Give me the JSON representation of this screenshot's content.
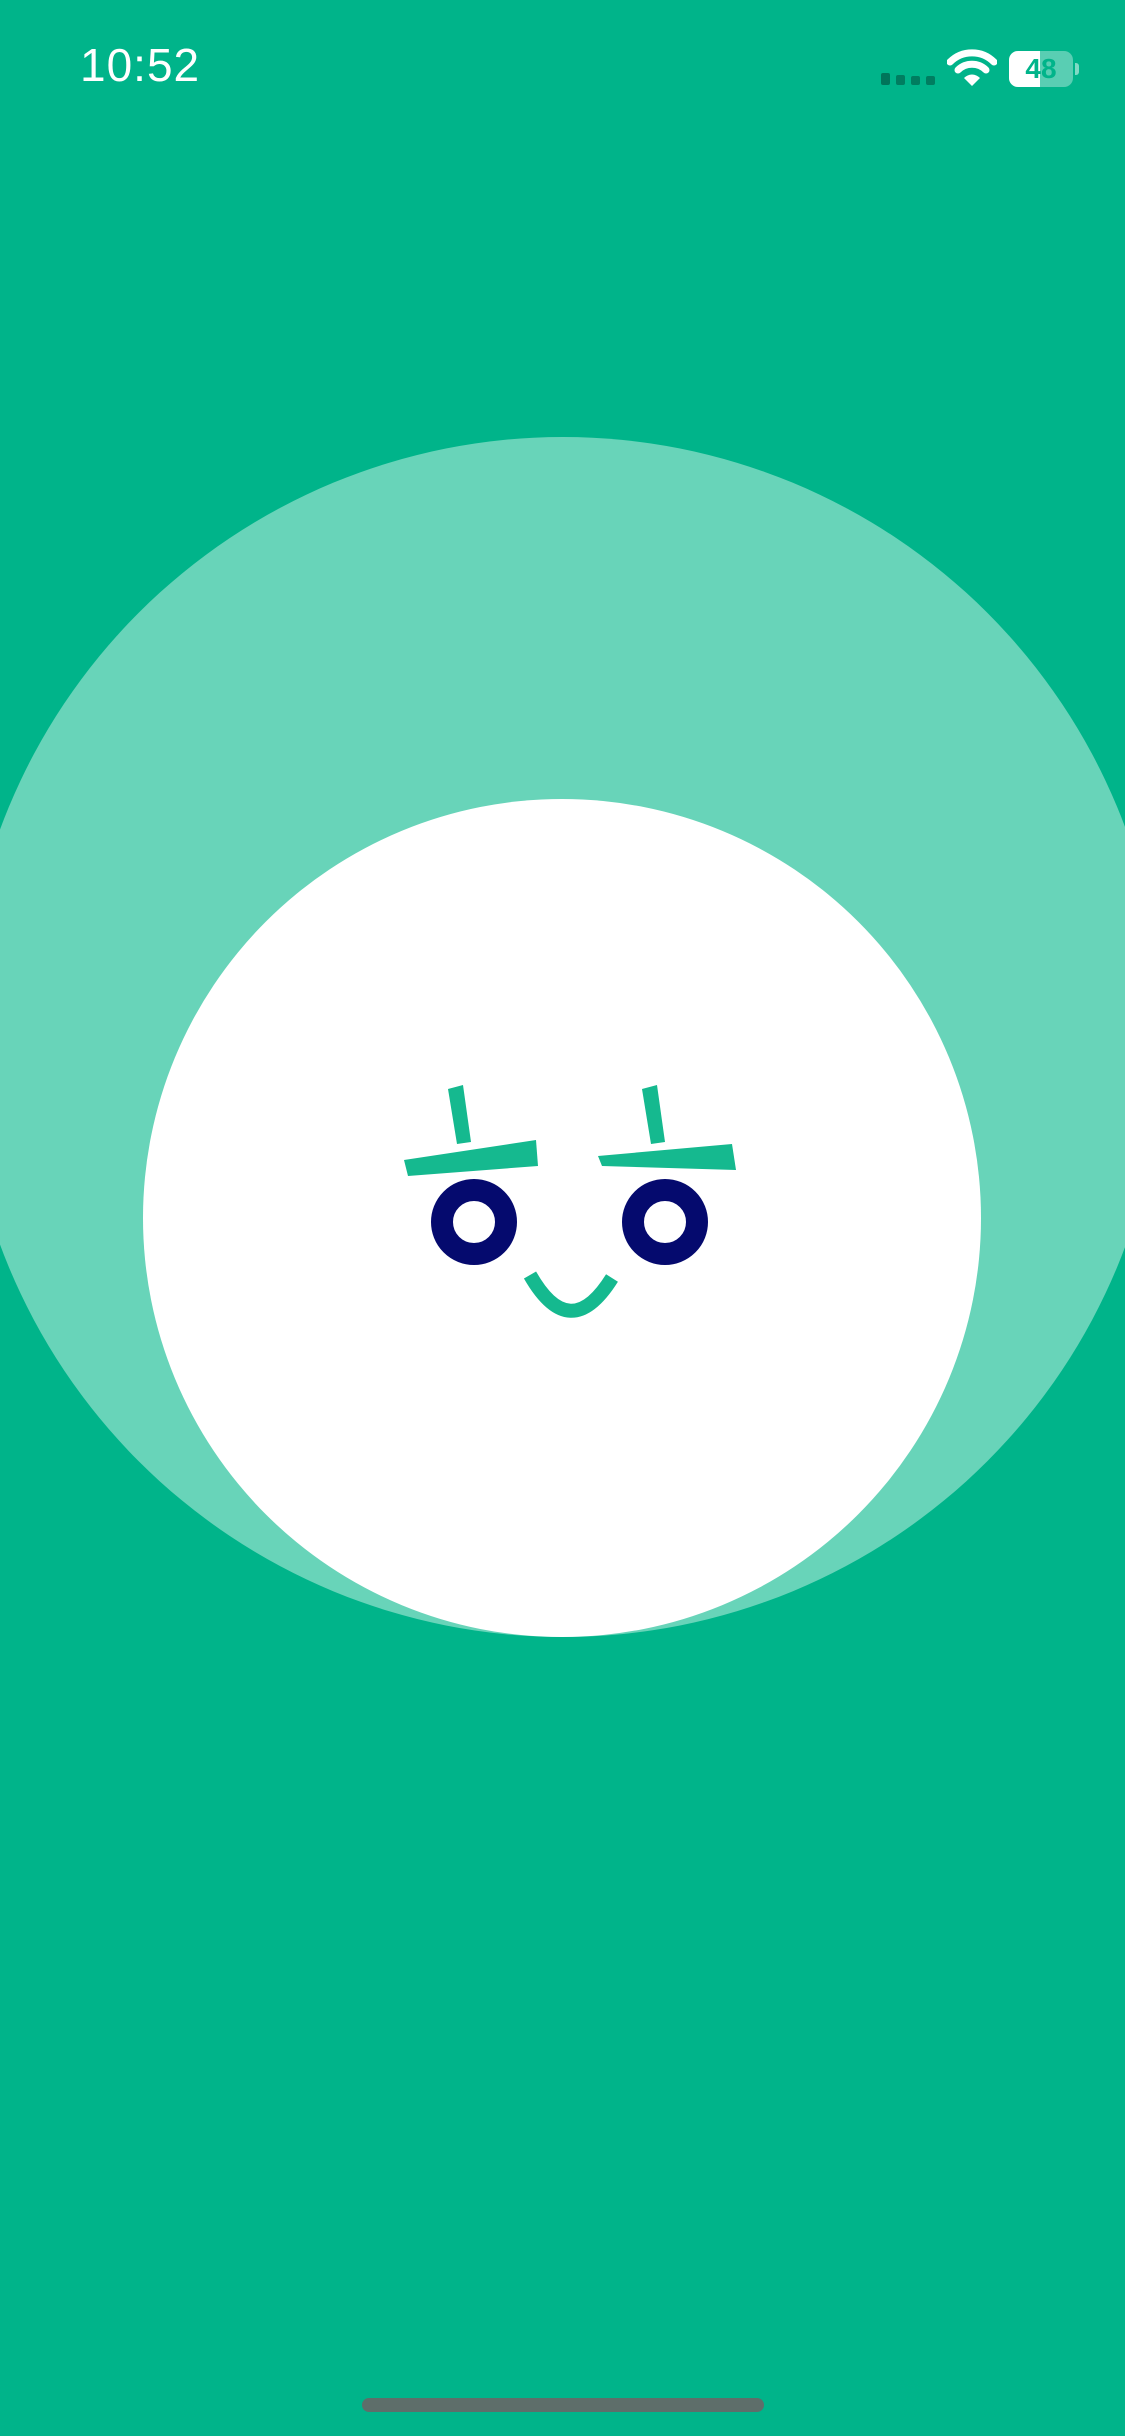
{
  "colors": {
    "background": "#00b48a",
    "outer_ring": "#68d4b9",
    "inner_circle": "#ffffff",
    "eyebrow": "#15b98f",
    "eye": "#050a6e",
    "mouth": "#15b98f",
    "status_text": "#ffffff",
    "battery_text": "#00b48a",
    "home_indicator": "#5e6e6a"
  },
  "status_bar": {
    "time": "10:52",
    "signal_icon": "cellular-signal-icon",
    "wifi_icon": "wifi-icon",
    "battery_percent": "48",
    "battery_level": 0.48
  },
  "mascot": {
    "expression": "smiling"
  }
}
